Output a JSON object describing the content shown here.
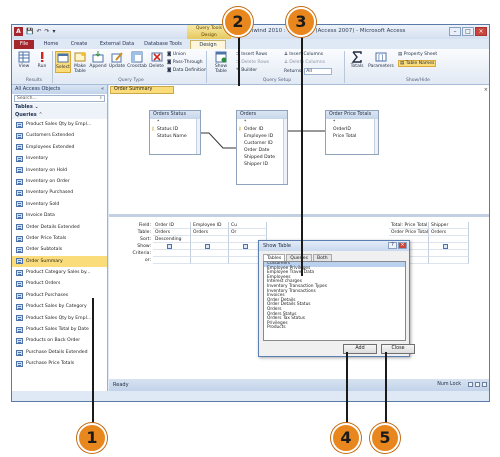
{
  "window": {
    "app_icon_letter": "A",
    "quick_access": [
      "💾",
      "↶",
      "↷",
      "▾"
    ],
    "tools_tab_line1": "Query Tools",
    "tools_tab_line2": "Design",
    "title": "Northwind 2010 : Database (Access 2007) - Microsoft Access",
    "controls": [
      "–",
      "□",
      "×"
    ]
  },
  "tabs": [
    {
      "label": "File"
    },
    {
      "label": "Home"
    },
    {
      "label": "Create"
    },
    {
      "label": "External Data"
    },
    {
      "label": "Database Tools"
    },
    {
      "label": "Design"
    }
  ],
  "ribbon": {
    "view": "View",
    "run": "Run",
    "select": "Select",
    "make_table": "Make Table",
    "append": "Append",
    "update": "Update",
    "crosstab": "Crosstab",
    "delete": "Delete",
    "union": "Union",
    "pass_through": "Pass-Through",
    "data_definition": "Data Definition",
    "show_table": "Show Table",
    "insert_rows": "Insert Rows",
    "delete_rows": "Delete Rows",
    "builder": "Builder",
    "insert_columns": "Insert Columns",
    "delete_columns": "Delete Columns",
    "returns_label": "Returns:",
    "returns_value": "All",
    "totals": "Totals",
    "parameters": "Parameters",
    "property_sheet": "Property Sheet",
    "table_names": "Table Names",
    "groups": {
      "results": "Results",
      "query_type": "Query Type",
      "query_setup": "Query Setup",
      "show_hide": "Show/Hide"
    }
  },
  "nav": {
    "header": "All Access Objects",
    "search_placeholder": "Search...",
    "category_tables": "Tables",
    "category_queries": "Queries",
    "items": [
      "Product Sales Qty by Empl...",
      "Customers Extended",
      "Employees Extended",
      "Inventory",
      "Inventory on Hold",
      "Inventory on Order",
      "Inventory Purchased",
      "Inventory Sold",
      "Invoice Data",
      "Order Details Extended",
      "Order Price Totals",
      "Order Subtotals",
      "Order Summary",
      "Product Category Sales by...",
      "Product Orders",
      "Product Purchases",
      "Product Sales by Category",
      "Product Sales Qty by Empl...",
      "Product Sales Total by Date",
      "Products on Back Order",
      "Purchase Details Extended",
      "Purchase Price Totals"
    ],
    "selected_index": 12
  },
  "doc": {
    "tab_label": "Order Summary",
    "tables": [
      {
        "title": "Orders Status",
        "fields": [
          "*",
          "Status ID",
          "Status Name"
        ],
        "keys": [
          1
        ]
      },
      {
        "title": "Orders",
        "fields": [
          "*",
          "Order ID",
          "Employee ID",
          "Customer ID",
          "Order Date",
          "Shipped Date",
          "Shipper ID"
        ],
        "keys": [
          1
        ]
      },
      {
        "title": "Order Price Totals",
        "fields": [
          "*",
          "OrderID",
          "Price Total"
        ],
        "keys": []
      }
    ],
    "grid_labels": [
      "Field:",
      "Table:",
      "Sort:",
      "Show:",
      "Criteria:",
      "or:"
    ],
    "grid_columns": [
      {
        "field": "Order ID",
        "table": "Orders",
        "sort": "Descending",
        "show": true
      },
      {
        "field": "Employee ID",
        "table": "Orders",
        "sort": "",
        "show": true
      },
      {
        "field": "Cu",
        "table": "Or",
        "sort": "",
        "show": true
      },
      {
        "field": "Total: Price Total",
        "table": "Order Price Totals",
        "sort": "",
        "show": true
      },
      {
        "field": "Shipper",
        "table": "Orders",
        "sort": "",
        "show": true
      }
    ]
  },
  "dialog": {
    "title": "Show Table",
    "title_buttons": [
      "?",
      "×"
    ],
    "tabs": [
      "Tables",
      "Queries",
      "Both"
    ],
    "items": [
      "Customers",
      "Employee Privileges",
      "Employee Travel Data",
      "Employees",
      "Interest charges",
      "Inventory Transaction Types",
      "Inventory Transactions",
      "Invoices",
      "Order Details",
      "Order Details Status",
      "Orders",
      "Orders Status",
      "Orders Tax Status",
      "Privileges",
      "Products"
    ],
    "selected_index": 0,
    "add_label": "Add",
    "close_label": "Close"
  },
  "status": {
    "left": "Ready",
    "right": "Num Lock"
  },
  "callouts": [
    "1",
    "2",
    "3",
    "4",
    "5"
  ]
}
